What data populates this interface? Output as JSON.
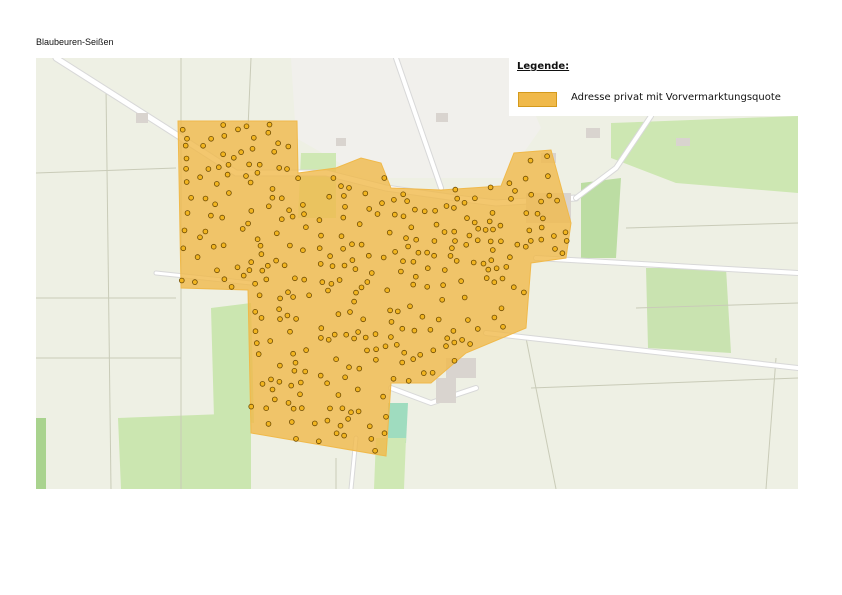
{
  "page": {
    "title": "Blaubeuren-Seißen"
  },
  "legend": {
    "title": "Legende:",
    "items": [
      {
        "label": "Adresse privat mit Vorvermarktungsquote",
        "color": "#f0b94a",
        "border": "#d49a1c"
      }
    ]
  },
  "map": {
    "colors": {
      "land": "#eef0e4",
      "settlement": "#f3f2ee",
      "meadow": "#cfe8b4",
      "field_line": "#c9cbb8",
      "road": "#ffffff",
      "road_casing": "#d8d8d8",
      "coverage": "#f0b94a",
      "marker_fill": "#f2b520",
      "marker_stroke": "#6d4a00"
    },
    "marker_style": "address-dot"
  }
}
